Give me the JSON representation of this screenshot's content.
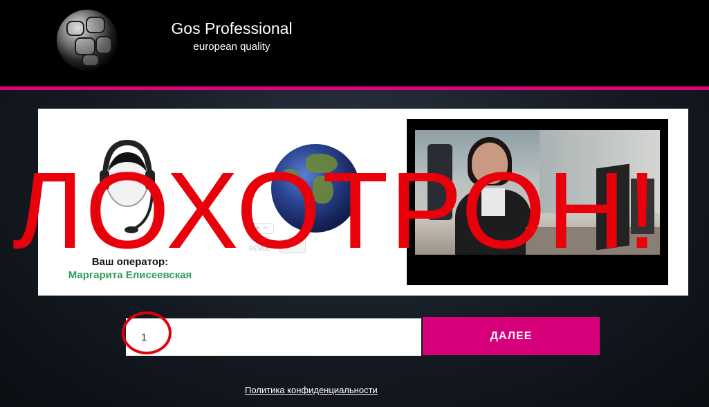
{
  "header": {
    "brand_title": "Gos Professional",
    "brand_subtitle": "european quality",
    "logo_icon": "metal-ball-logo",
    "accent_line_color": "#e6007e"
  },
  "panel": {
    "operator_label": "Ваш оператор:",
    "operator_name": "Маргарита Елисеевская",
    "operator_avatar_icon": "headset-operator-icon",
    "globe_icon": "earth-globe-icon",
    "map_widget_text": "REVOL"
  },
  "overlay": {
    "scam_text": "ЛОХОТРОН!",
    "color": "#e8000b"
  },
  "form": {
    "input_value": "1",
    "next_button_label": "ДАЛЕЕ",
    "button_color": "#d7007b"
  },
  "footer": {
    "privacy_link": "Политика конфиденциальности"
  }
}
